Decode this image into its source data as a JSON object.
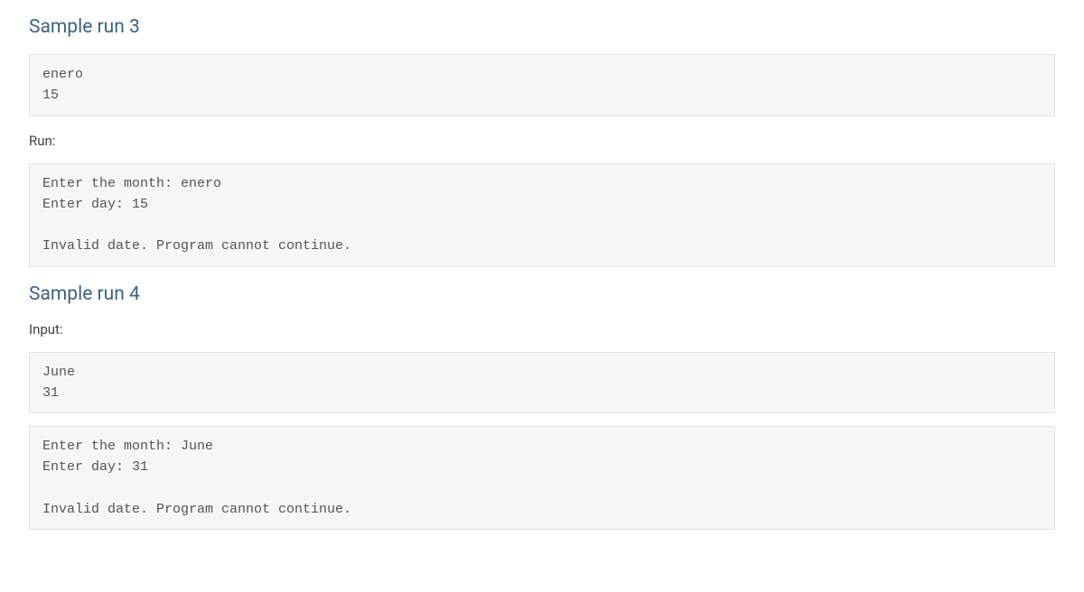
{
  "run3": {
    "heading": "Sample run 3",
    "input_block": "enero\n15",
    "run_label": "Run:",
    "output_block": "Enter the month: enero\nEnter day: 15\n\nInvalid date. Program cannot continue."
  },
  "run4": {
    "heading": "Sample run 4",
    "input_label": "Input:",
    "input_block": "June\n31",
    "output_block": "Enter the month: June\nEnter day: 31\n\nInvalid date. Program cannot continue."
  }
}
